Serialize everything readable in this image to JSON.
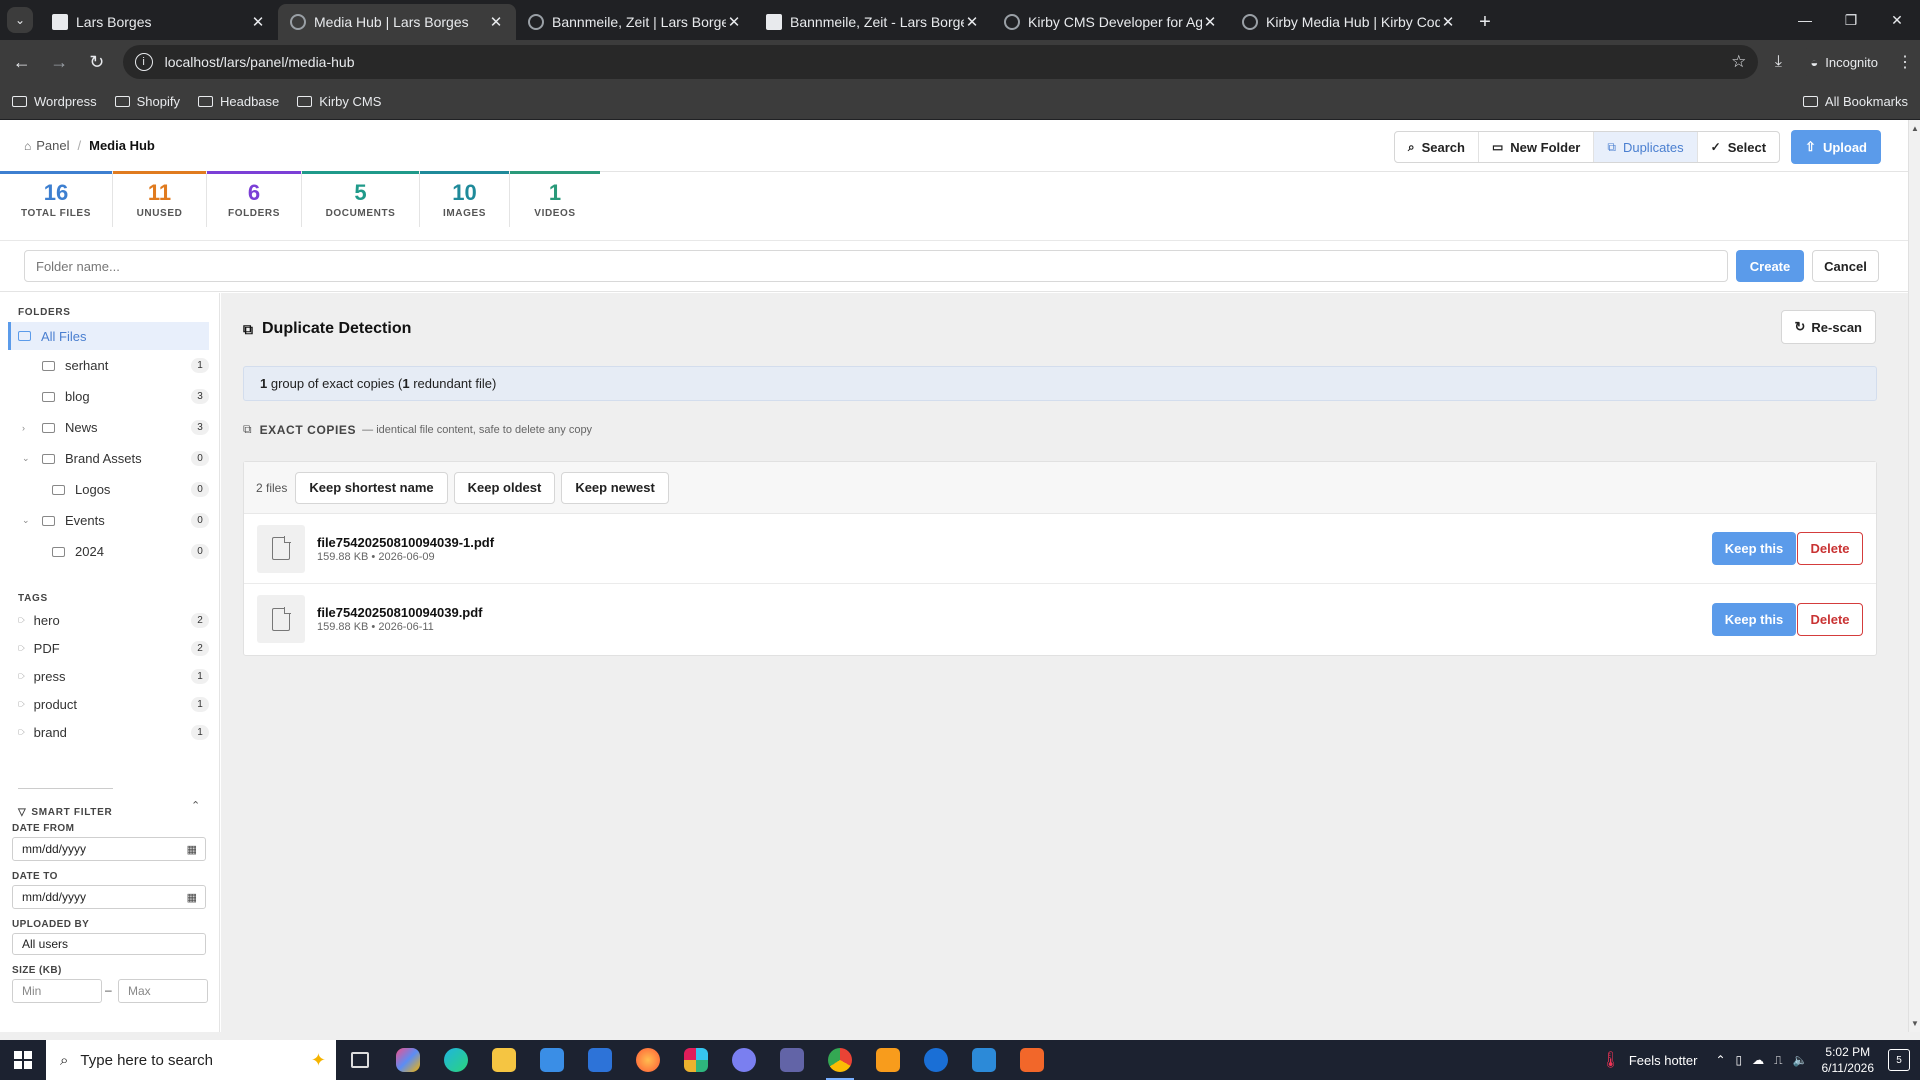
{
  "browser": {
    "tabs": [
      {
        "title": "Lars Borges",
        "active": false
      },
      {
        "title": "Media Hub | Lars Borges",
        "active": true
      },
      {
        "title": "Bannmeile, Zeit | Lars Borges",
        "active": false
      },
      {
        "title": "Bannmeile, Zeit - Lars Borges",
        "active": false
      },
      {
        "title": "Kirby CMS Developer for Agenc",
        "active": false
      },
      {
        "title": "Kirby Media Hub | Kirby Code",
        "active": false
      }
    ],
    "url": "localhost/lars/panel/media-hub",
    "incognito_label": "Incognito",
    "bookmarks": [
      "Wordpress",
      "Shopify",
      "Headbase",
      "Kirby CMS"
    ],
    "all_bookmarks": "All Bookmarks"
  },
  "header": {
    "breadcrumb": [
      "Panel",
      "Media Hub"
    ],
    "buttons": {
      "search": "Search",
      "new_folder": "New Folder",
      "duplicates": "Duplicates",
      "select": "Select",
      "upload": "Upload"
    }
  },
  "stats": [
    {
      "value": "16",
      "label": "TOTAL FILES",
      "color": "#3d7fd0"
    },
    {
      "value": "11",
      "label": "UNUSED",
      "color": "#e07b1f"
    },
    {
      "value": "6",
      "label": "FOLDERS",
      "color": "#7b3fd6"
    },
    {
      "value": "5",
      "label": "DOCUMENTS",
      "color": "#1f9a8a"
    },
    {
      "value": "10",
      "label": "IMAGES",
      "color": "#1f8a9a"
    },
    {
      "value": "1",
      "label": "VIDEOS",
      "color": "#2a9a7a"
    }
  ],
  "folder_form": {
    "placeholder": "Folder name...",
    "create": "Create",
    "cancel": "Cancel"
  },
  "sidebar": {
    "folders_heading": "FOLDERS",
    "all_files": "All Files",
    "folders": [
      {
        "name": "serhant",
        "count": "1",
        "indent": 1,
        "caret": ""
      },
      {
        "name": "blog",
        "count": "3",
        "indent": 1,
        "caret": ""
      },
      {
        "name": "News",
        "count": "3",
        "indent": 1,
        "caret": "›"
      },
      {
        "name": "Brand Assets",
        "count": "0",
        "indent": 1,
        "caret": "⌄"
      },
      {
        "name": "Logos",
        "count": "0",
        "indent": 2,
        "caret": ""
      },
      {
        "name": "Events",
        "count": "0",
        "indent": 1,
        "caret": "⌄"
      },
      {
        "name": "2024",
        "count": "0",
        "indent": 2,
        "caret": ""
      }
    ],
    "tags_heading": "TAGS",
    "tags": [
      {
        "name": "hero",
        "count": "2"
      },
      {
        "name": "PDF",
        "count": "2"
      },
      {
        "name": "press",
        "count": "1"
      },
      {
        "name": "product",
        "count": "1"
      },
      {
        "name": "brand",
        "count": "1"
      }
    ],
    "smart_filter": {
      "heading": "SMART FILTER",
      "date_from_label": "DATE FROM",
      "date_from_value": "mm/dd/yyyy",
      "date_to_label": "DATE TO",
      "date_to_value": "mm/dd/yyyy",
      "uploaded_by_label": "UPLOADED BY",
      "uploaded_by_value": "All users",
      "size_label": "SIZE (KB)",
      "min_placeholder": "Min",
      "max_placeholder": "Max",
      "dash": "–"
    }
  },
  "main": {
    "title": "Duplicate Detection",
    "rescan": "Re-scan",
    "summary": {
      "n1": "1",
      "t1": " group of exact copies (",
      "n2": "1",
      "t2": " redundant file)"
    },
    "exact_heading": "EXACT COPIES",
    "exact_desc": "— identical file content, safe to delete any copy",
    "group": {
      "count_label": "2 files",
      "keep_shortest": "Keep shortest name",
      "keep_oldest": "Keep oldest",
      "keep_newest": "Keep newest",
      "files": [
        {
          "name": "file75420250810094039-1.pdf",
          "meta": "159.88 KB • 2026-06-09",
          "keep": "Keep this",
          "delete": "Delete"
        },
        {
          "name": "file75420250810094039.pdf",
          "meta": "159.88 KB • 2026-06-11",
          "keep": "Keep this",
          "delete": "Delete"
        }
      ]
    }
  },
  "taskbar": {
    "search_placeholder": "Type here to search",
    "weather": "Feels hotter",
    "time": "5:02 PM",
    "date": "6/11/2026",
    "notification_count": "5"
  }
}
